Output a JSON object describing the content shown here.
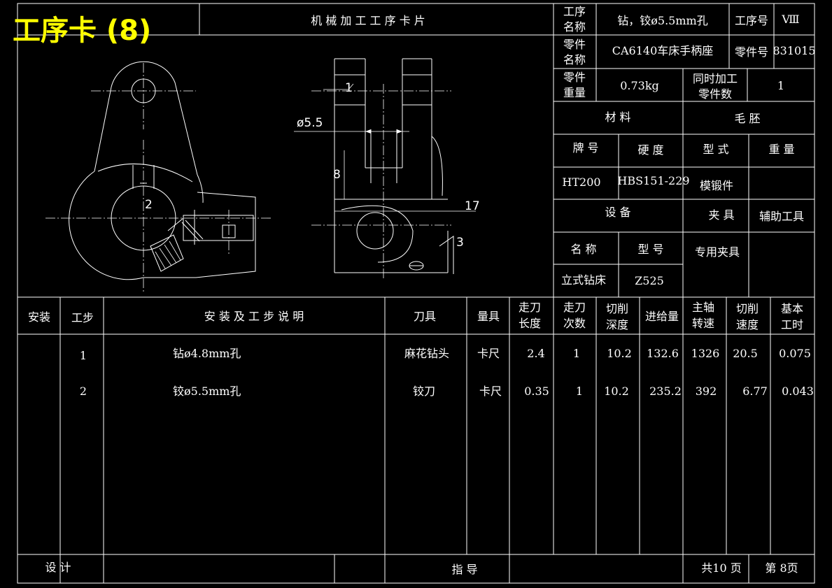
{
  "card_title": "工序卡 (8)",
  "header": {
    "sheet_title": "机 械 加 工 工 序 卡 片",
    "op_name_label": [
      "工序",
      "名称"
    ],
    "op_name": "钻，铰ø5.5mm孔",
    "op_no_label": "工序号",
    "op_no": "Ⅷ",
    "part_name_label": [
      "零件",
      "名称"
    ],
    "part_name": "CA6140车床手柄座",
    "part_no_label": "零件号",
    "part_no": "831015",
    "part_weight_label": [
      "零件",
      "重量"
    ],
    "part_weight": "0.73kg",
    "simul_label": [
      "同时加工",
      "零件数"
    ],
    "simul_count": "1"
  },
  "material": {
    "material_label": "材    料",
    "blank_label": "毛      胚",
    "grade_label": "牌  号",
    "hardness_label": "硬  度",
    "form_label": "型  式",
    "weight_label": "重  量",
    "grade": "HT200",
    "hardness": "HBS151-229",
    "form": "模锻件",
    "weight": ""
  },
  "equipment": {
    "equipment_label": "设      备",
    "fixture_label": "夹  具",
    "aux_tool_label": "辅助工具",
    "name_label": "名  称",
    "model_label": "型  号",
    "name": "立式钻床",
    "model": "Z525",
    "fixture": "专用夹具",
    "aux_tool": ""
  },
  "drawing": {
    "label_1": "1",
    "label_2": "2",
    "label_3": "3",
    "dim_dia": "ø5.5",
    "dim_8": "8",
    "dim_17": "17"
  },
  "steps_table": {
    "headers": {
      "install": "安装",
      "step": "工步",
      "desc": "安  装  及  工  步  说  明",
      "tool": "刀具",
      "gauge": "量具",
      "feed_len": [
        "走刀",
        "长度"
      ],
      "passes": [
        "走刀",
        "次数"
      ],
      "depth": [
        "切削",
        "深度"
      ],
      "feed": "进给量",
      "speed": [
        "主轴",
        "转速"
      ],
      "cut_speed": [
        "切削",
        "速度"
      ],
      "time": [
        "基本",
        "工时"
      ]
    },
    "rows": [
      {
        "install": "",
        "step": "1",
        "desc": "钻ø4.8mm孔",
        "tool": "麻花钻头",
        "gauge": "卡尺",
        "feed_len": "2.4",
        "passes": "1",
        "depth": "10.2",
        "feed": "132.6",
        "speed": "1326",
        "cut_speed": "20.5",
        "time": "0.075"
      },
      {
        "install": "",
        "step": "2",
        "desc": "铰ø5.5mm孔",
        "tool": "铰刀",
        "gauge": "卡尺",
        "feed_len": "0.35",
        "passes": "1",
        "depth": "10.2",
        "feed": "235.2",
        "speed": "392",
        "cut_speed": "6.77",
        "time": "0.043"
      }
    ]
  },
  "footer": {
    "designer_label": "设    计",
    "designer": "",
    "supervisor_label": "指    导",
    "supervisor": "",
    "total_pages": "共10 页",
    "page_no": "第  8页"
  }
}
